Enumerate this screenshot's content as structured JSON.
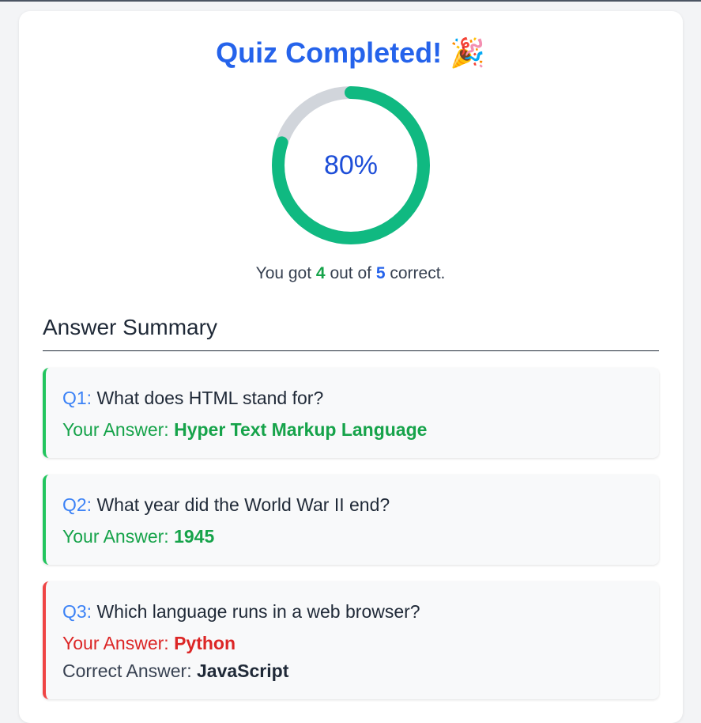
{
  "header": {
    "title": "Quiz Completed!",
    "emoji": "🎉"
  },
  "score": {
    "percent_label": "80%",
    "percent_value": 0.8,
    "text_prefix": "You got",
    "correct": "4",
    "text_middle": "out of",
    "total": "5",
    "text_suffix": "correct."
  },
  "colors": {
    "ring_fill": "#10b981",
    "ring_track": "#d1d5db",
    "accent": "#2563eb",
    "correct": "#16a34a",
    "wrong": "#dc2626"
  },
  "summary": {
    "title": "Answer Summary",
    "your_answer_label": "Your Answer:",
    "correct_answer_label": "Correct Answer:",
    "items": [
      {
        "num": "Q1:",
        "question": "What does HTML stand for?",
        "your_answer": "Hyper Text Markup Language",
        "is_correct": true
      },
      {
        "num": "Q2:",
        "question": "What year did the World War II end?",
        "your_answer": "1945",
        "is_correct": true
      },
      {
        "num": "Q3:",
        "question": "Which language runs in a web browser?",
        "your_answer": "Python",
        "is_correct": false,
        "correct_answer": "JavaScript"
      }
    ]
  }
}
